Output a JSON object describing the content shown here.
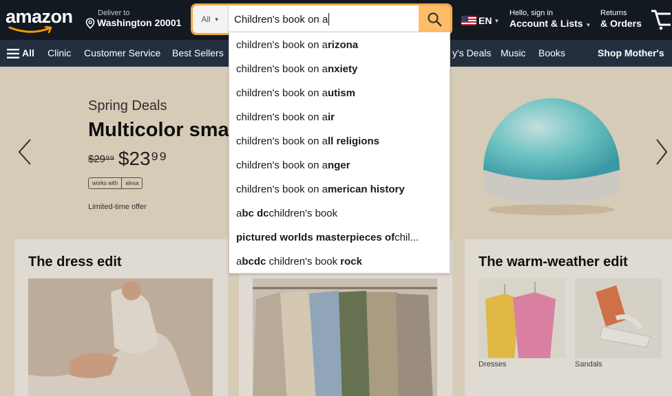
{
  "header": {
    "logo_text": "amazon",
    "deliver_label": "Deliver to",
    "deliver_location": "Washington 20001",
    "search_category": "All",
    "search_query": "Children's book on a",
    "language": "EN",
    "account_greeting": "Hello, sign in",
    "account_label": "Account & Lists",
    "returns_label": "Returns",
    "orders_label": "& Orders"
  },
  "subnav": {
    "all_label": "All",
    "items": [
      "Clinic",
      "Customer Service",
      "Best Sellers",
      "y's Deals",
      "Music",
      "Books"
    ],
    "promo": "Shop Mother's"
  },
  "suggestions": [
    {
      "light": "children's book on a",
      "bold": "rizona",
      "tail": ""
    },
    {
      "light": "children's book on a",
      "bold": "nxiety",
      "tail": ""
    },
    {
      "light": "children's book on a",
      "bold": "utism",
      "tail": ""
    },
    {
      "light": "children's book on a",
      "bold": "ir",
      "tail": ""
    },
    {
      "light": "children's book on a",
      "bold": "ll religions",
      "tail": ""
    },
    {
      "light": "children's book on a",
      "bold": "nger",
      "tail": ""
    },
    {
      "light": "children's book on a",
      "bold": "merican history",
      "tail": ""
    },
    {
      "light": "a",
      "bold": "bc dc",
      "tail": " children's book"
    },
    {
      "light": "",
      "bold": "pictured worlds masterpieces of",
      "tail": " chil..."
    },
    {
      "light": "a",
      "bold": "bcdc",
      "tail": " children's book ",
      "bold2": "rock"
    }
  ],
  "hero": {
    "kicker": "Spring Deals",
    "title": "Multicolor sma",
    "old_price": "$29⁹⁹",
    "new_price": "$23⁹⁹",
    "badge_left": "works with",
    "badge_right": "alexa",
    "offer": "Limited-time offer"
  },
  "cards": {
    "dress_title": "The dress edit",
    "warm_title": "The warm-weather edit",
    "warm_thumb_1": "Dresses",
    "warm_thumb_2": "Sandals"
  },
  "colors": {
    "nav_bg": "#131921",
    "subnav_bg": "#232f3e",
    "search_button": "#febd69",
    "accent": "#f3a847"
  }
}
